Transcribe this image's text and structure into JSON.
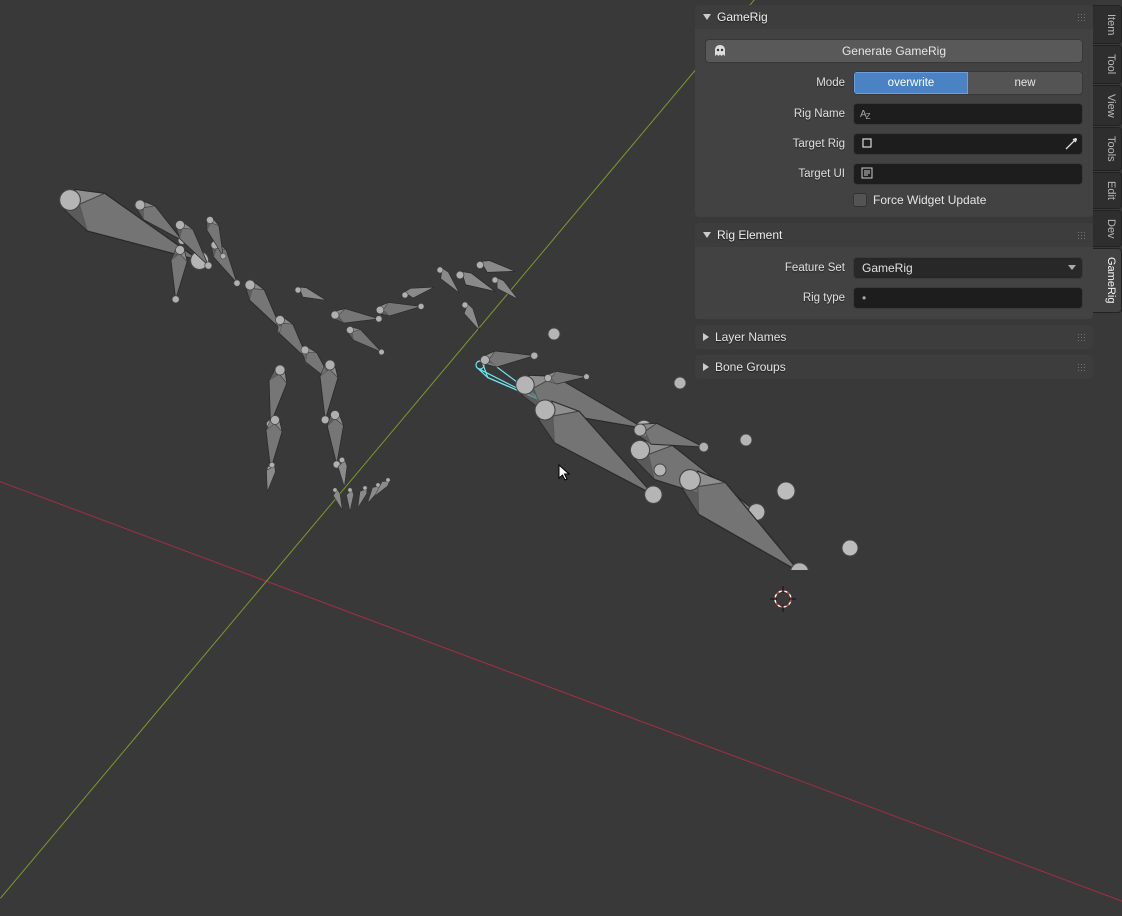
{
  "panels": {
    "gamerig_title": "GameRig",
    "generate_btn": "Generate GameRig",
    "mode_label": "Mode",
    "mode_overwrite": "overwrite",
    "mode_new": "new",
    "rig_name_label": "Rig Name",
    "rig_name_value": "",
    "target_rig_label": "Target Rig",
    "target_rig_value": "",
    "target_ui_label": "Target UI",
    "target_ui_value": "",
    "force_widget_label": "Force Widget Update",
    "rig_element_title": "Rig Element",
    "feature_set_label": "Feature Set",
    "feature_set_value": "GameRig",
    "rig_type_label": "Rig type",
    "rig_type_value": "•",
    "layer_names_title": "Layer Names",
    "bone_groups_title": "Bone Groups"
  },
  "tabs": {
    "item": "Item",
    "tool": "Tool",
    "view": "View",
    "tools": "Tools",
    "edit": "Edit",
    "dev": "Dev",
    "gamerig": "GameRig"
  }
}
